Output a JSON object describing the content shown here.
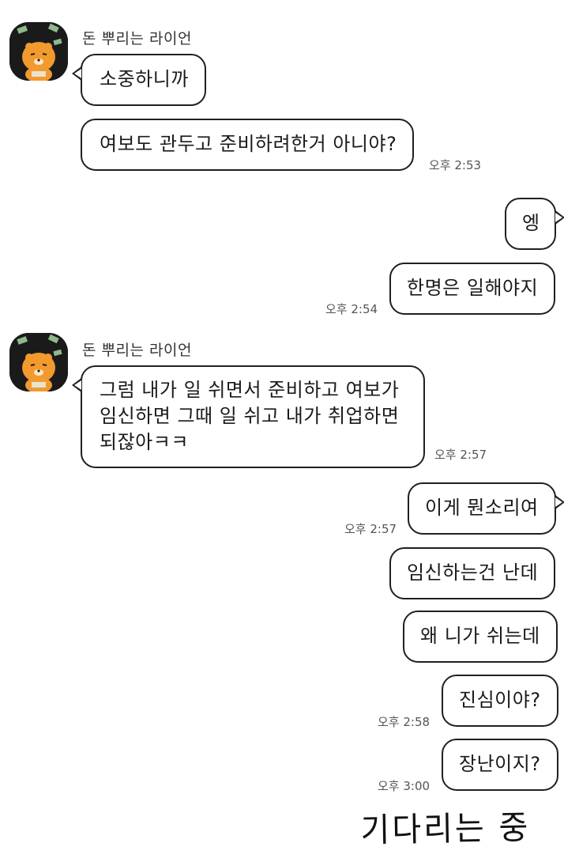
{
  "sender": {
    "name": "돈 뿌리는 라이언"
  },
  "messages": [
    {
      "id": 1,
      "side": "left",
      "text": "소중하니까",
      "time": ""
    },
    {
      "id": 2,
      "side": "left",
      "text": "여보도 관두고 준비하려한거 아니야?",
      "time": "오후 2:53"
    },
    {
      "id": 3,
      "side": "right",
      "text": "엥",
      "time": ""
    },
    {
      "id": 4,
      "side": "right",
      "text": "한명은 일해야지",
      "time": "오후 2:54"
    },
    {
      "id": 5,
      "side": "left",
      "text": "그럼 내가 일 쉬면서 준비하고 여보가 임신하면 그때 일 쉬고 내가 취업하면 되잖아ㅋㅋ",
      "time": "오후 2:57"
    },
    {
      "id": 6,
      "side": "right",
      "text": "이게 뭔소리여",
      "time": "오후 2:57"
    },
    {
      "id": 7,
      "side": "right",
      "text": "임신하는건 난데",
      "time": ""
    },
    {
      "id": 8,
      "side": "right",
      "text": "왜 니가 쉬는데",
      "time": ""
    },
    {
      "id": 9,
      "side": "right",
      "text": "진심이야?",
      "time": "오후 2:58"
    },
    {
      "id": 10,
      "side": "right",
      "text": "장난이지?",
      "time": "오후 3:00"
    }
  ],
  "caption": "기다리는 중",
  "icons": {
    "avatar": "lion-character-throwing-money"
  },
  "colors": {
    "background": "#ffffff",
    "bubble_border": "#202020",
    "text": "#1a1a1a",
    "time": "#555555"
  }
}
